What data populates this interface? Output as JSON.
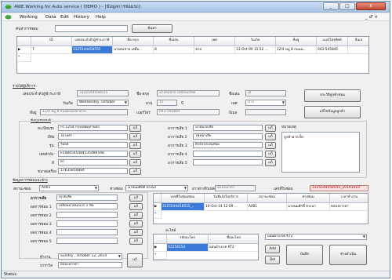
{
  "window": {
    "title": "AWE Working for Auto service ( DEMO ) - [ข้อมูลการซ่อมรถ]",
    "minimize": "_",
    "restore": "□",
    "close": "x"
  },
  "menu": {
    "items": [
      "Working",
      "Data",
      "Edit",
      "History",
      "Help"
    ],
    "right_controls": "_ ♂ ×"
  },
  "search": {
    "label": "ค้นหาการซ่อม",
    "value": "",
    "button": "ค้นหา"
  },
  "results_grid": {
    "headers": [
      "ID",
      "เลขประจำตัวผู้ชำระภาษี",
      "ชื่อ-สกุล",
      "ชื่อเล่น",
      "เพศ",
      "วันเกิด",
      "ที่อยู่",
      "เบอร์โทรศัพท์",
      "อีเมล"
    ],
    "rows": [
      [
        "7",
        "3325544458555",
        "นายสมชาย เสมือ...",
        "ต้",
        "ชาย",
        "13-Oct-99 11:52 ...",
        "12/4 หมู่ 8 ถนนน...",
        "043-545845",
        ""
      ]
    ],
    "new_row_marker": "*",
    "current_row_marker": "▶"
  },
  "customer_section": {
    "header": "รายได้ผู้บริการ",
    "tax_label": "เลขประจำตัวผู้ชำระภาษี",
    "tax_value": "3325544458555",
    "name_label": "ชื่อ-สกุล",
    "name_value": "นายสมชาย เสมือนทรัพย์",
    "nick_label": "ชื่อเล่น",
    "nick_value": "เต้",
    "birth_label": "วันเกิด",
    "birth_value": "Wednesday,  October",
    "age_label": "อายุ",
    "age_value": "15",
    "age_unit": "ปี",
    "sex_label": "เพศ",
    "sex_value": "ชาย",
    "addr_label": "ที่อยู่",
    "addr_value": "12/4 หมู่ 8 ถนนดอนปลาดาย",
    "phone_label": "เบอร์โทร",
    "phone_value": "043-545845",
    "email_label": "อีเมล",
    "email_value": "",
    "btn_customer_info": "ประวัติลูกค้าซ่อม",
    "btn_edit_customer": "แก้ไขข้อมูลลูกค้า"
  },
  "car_section": {
    "header": "ข้อมูลรถยนต์",
    "plate_label": "ทะเบียนรถ",
    "plate_value": "กร 1254 กรุงเทพมหานคร",
    "brand_label": "ยี่ห้อ",
    "brand_value": "โตโยต้า",
    "model_label": "รุ่น",
    "model_value": "วีออส",
    "engine_label": "เลขตัวถัง",
    "engine_value": "E5484545484535486548",
    "color_label": "สี",
    "color_value": "ดำ",
    "chassis_label": "ขนาดเครื่อง",
    "chassis_value": "17K35854884",
    "btn_label": "แก้",
    "symptom_labels": [
      "อาการเสีย 1",
      "อาการเสีย 2",
      "อาการเสีย 3",
      "อาการเสีย 4",
      "อาการเสีย 5"
    ],
    "symptom_values": [
      "น้ำมันรถเสีย",
      "ไฟหน้าเสีย",
      "ตัวถังรถเป็นสนิม",
      "",
      ""
    ],
    "note_label": "หมายเหตุ",
    "note_value": "ลูกค้าฝากเช็ก"
  },
  "repair_section": {
    "header": "ข้อมูลการซ่อมและช่าง",
    "status_label": "สถานะซ่อม",
    "status_value": "A001",
    "mechanic_label": "ช่างซ่อม",
    "mechanic_value": "นายนมศักดิ์ ทรงนา",
    "tel_label": "ผ่าวต่างทิวเทค",
    "tel_value": "คลองเยวลา",
    "job_label": "เลขที่ใบซ่อม",
    "job_value": "3325544458555_20141010",
    "work_labels": [
      "อาการเสีย",
      "ผลการซ่อม 1",
      "ผลการซ่อม 2",
      "ผลการซ่อม 3",
      "ผลการซ่อม 4",
      "ผลการซ่อม 5"
    ],
    "work_values": [
      "เบรคเสีย",
      "เปลี่ยนน้ำมันเบรก 1 ขีด",
      "",
      "",
      "",
      ""
    ],
    "date_label": "ทำงาน",
    "date_value": "Sunday  ,  October  12, 2014",
    "staff_label": "ปาราวิส",
    "staff_value": "คลองหวาดา",
    "btn_label": "แก้"
  },
  "jobs_grid": {
    "headers": [
      "เลขที่ใบซ่อมซ่อม",
      "วันที่แจ้งใบบริการ",
      "สถานะซ่อม",
      "ช่างซ่อม",
      "เวลาทำงาน"
    ],
    "rows": [
      [
        "3325544458555_...",
        "10-Oct-14 12:09 ...",
        "A001",
        "นายนมศักดิ์ ทรงนา",
        "คลองยาวลา"
      ]
    ],
    "new_row_marker": "*",
    "current_row_marker": "▶"
  },
  "parts_grid": {
    "header": "อะไหล่",
    "headers": [
      "รหัสอะไหล่",
      "ชื่ออะไหล่"
    ],
    "rows": [
      [
        "R2254554",
        "แผ่นผ้าเบรค KT2"
      ]
    ],
    "new_row_marker": "*",
    "current_row_marker": "▶"
  },
  "part_picker": {
    "value": "แผ่นผ้าเบรค KT2",
    "btn_add": "Add",
    "btn_del": "Del",
    "btn_save": "บันทึก",
    "btn_status": "ช่างดำเนิน"
  },
  "status": {
    "text": "Status"
  }
}
